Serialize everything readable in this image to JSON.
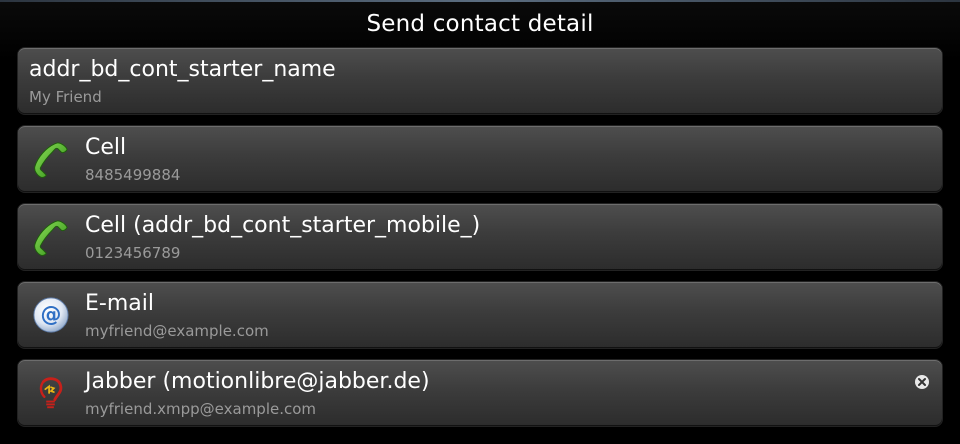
{
  "header": {
    "title": "Send contact detail"
  },
  "items": [
    {
      "label": "addr_bd_cont_starter_name",
      "value": "My Friend",
      "icon": ""
    },
    {
      "label": "Cell",
      "value": "8485499884",
      "icon": "phone-icon"
    },
    {
      "label": "Cell (addr_bd_cont_starter_mobile_)",
      "value": "0123456789",
      "icon": "phone-icon"
    },
    {
      "label": "E-mail",
      "value": "myfriend@example.com",
      "icon": "email-at-icon"
    },
    {
      "label": "Jabber (motionlibre@jabber.de)",
      "value": "myfriend.xmpp@example.com",
      "icon": "jabber-bulb-icon"
    }
  ],
  "colors": {
    "background": "#000000",
    "item_background": "#3c3c3c",
    "label_text": "#ffffff",
    "value_text": "#9a9a9a",
    "phone_green": "#3da81f",
    "email_blue": "#2f6fc4",
    "jabber_red": "#c8201a"
  }
}
